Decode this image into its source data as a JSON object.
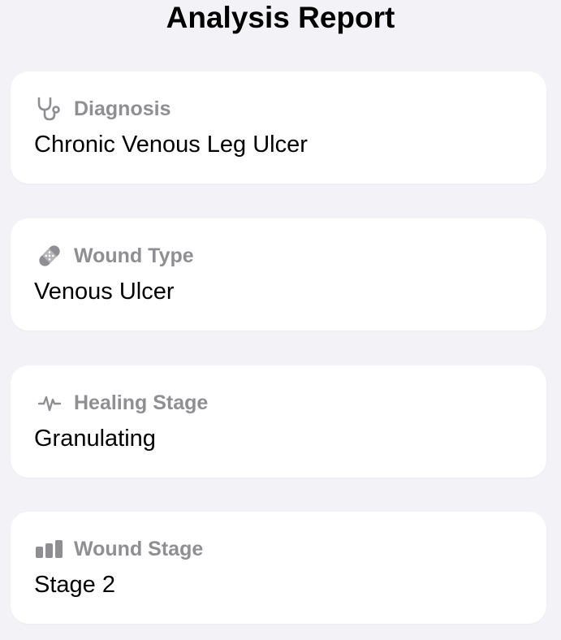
{
  "header": {
    "title": "Analysis Report"
  },
  "cards": [
    {
      "icon": "stethoscope-icon",
      "label": "Diagnosis",
      "value": "Chronic Venous Leg Ulcer"
    },
    {
      "icon": "bandage-icon",
      "label": "Wound Type",
      "value": "Venous Ulcer"
    },
    {
      "icon": "waveform-path-icon",
      "label": "Healing Stage",
      "value": "Granulating"
    },
    {
      "icon": "chart-bars-icon",
      "label": "Wound Stage",
      "value": "Stage 2"
    }
  ],
  "colors": {
    "background": "#f2f2f7",
    "card": "#ffffff",
    "label": "#8e8e93",
    "icon": "#8e8e93",
    "text": "#000000"
  }
}
